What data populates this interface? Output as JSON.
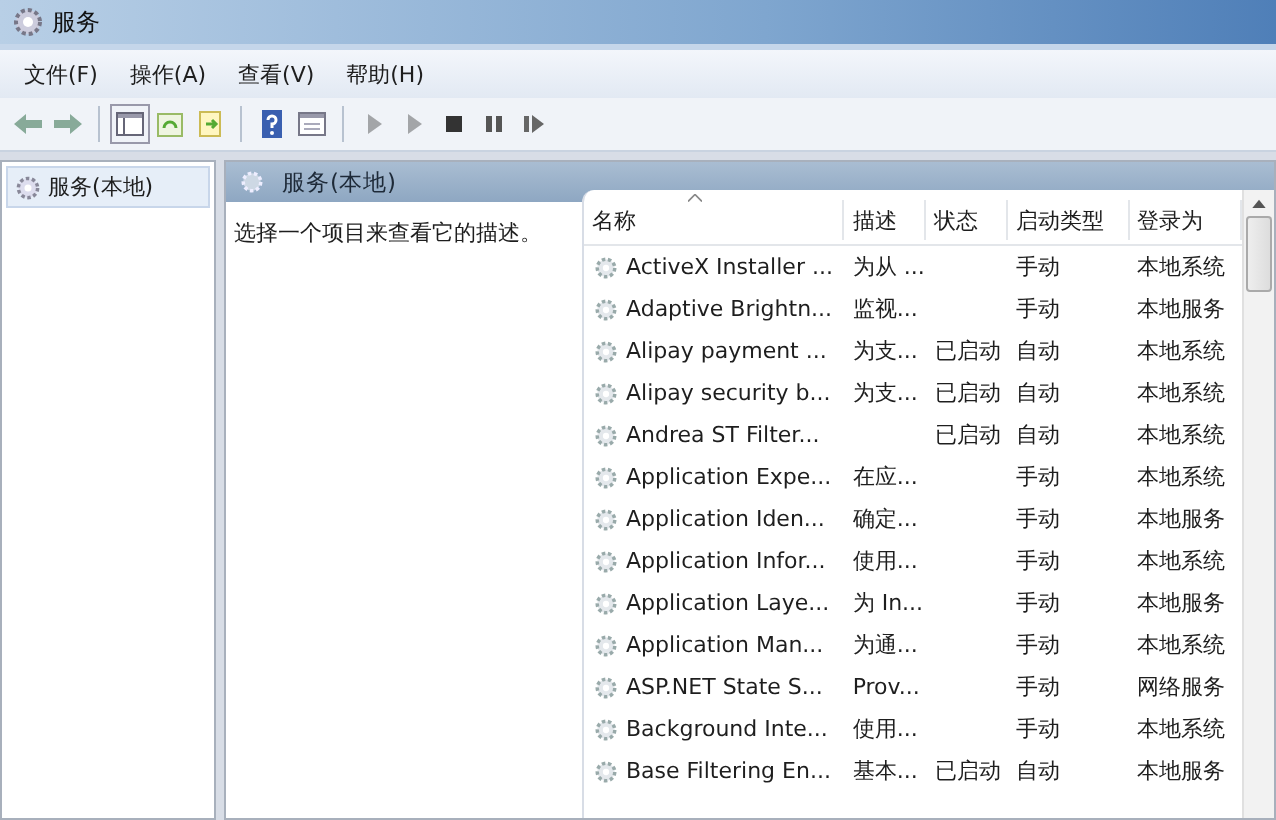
{
  "window": {
    "title": "服务"
  },
  "menu": [
    "文件(F)",
    "操作(A)",
    "查看(V)",
    "帮助(H)"
  ],
  "toolbar": [
    {
      "kind": "back",
      "disabled": false
    },
    {
      "kind": "forward",
      "disabled": false
    },
    {
      "kind": "sep"
    },
    {
      "kind": "tree",
      "disabled": false
    },
    {
      "kind": "refresh",
      "disabled": false
    },
    {
      "kind": "export",
      "disabled": false
    },
    {
      "kind": "sep"
    },
    {
      "kind": "help",
      "disabled": false
    },
    {
      "kind": "props",
      "disabled": false
    },
    {
      "kind": "sep"
    },
    {
      "kind": "play",
      "disabled": true
    },
    {
      "kind": "play",
      "disabled": true
    },
    {
      "kind": "stop",
      "disabled": false
    },
    {
      "kind": "pause",
      "disabled": false
    },
    {
      "kind": "restart",
      "disabled": false
    }
  ],
  "tree": {
    "items": [
      {
        "label": "服务(本地)",
        "selected": true
      }
    ]
  },
  "panel": {
    "title": "服务(本地)",
    "description": "选择一个项目来查看它的描述。"
  },
  "table": {
    "columns": [
      "名称",
      "描述",
      "状态",
      "启动类型",
      "登录为"
    ],
    "rows": [
      {
        "name": "ActiveX Installer ...",
        "description": "为从 ...",
        "startup": "手动",
        "logon": "本地系统"
      },
      {
        "name": "Adaptive Brightn...",
        "description": "监视...",
        "startup": "手动",
        "logon": "本地服务"
      },
      {
        "name": "Alipay payment ...",
        "description": "为支...",
        "status": "已启动",
        "startup": "自动",
        "logon": "本地系统"
      },
      {
        "name": "Alipay security b...",
        "description": "为支...",
        "status": "已启动",
        "startup": "自动",
        "logon": "本地系统"
      },
      {
        "name": "Andrea ST Filter...",
        "status": "已启动",
        "startup": "自动",
        "logon": "本地系统"
      },
      {
        "name": "Application Expe...",
        "description": "在应...",
        "startup": "手动",
        "logon": "本地系统"
      },
      {
        "name": "Application Iden...",
        "description": "确定...",
        "startup": "手动",
        "logon": "本地服务"
      },
      {
        "name": "Application Infor...",
        "description": "使用...",
        "startup": "手动",
        "logon": "本地系统"
      },
      {
        "name": "Application Laye...",
        "description": "为 In...",
        "startup": "手动",
        "logon": "本地服务"
      },
      {
        "name": "Application Man...",
        "description": "为通...",
        "startup": "手动",
        "logon": "本地系统"
      },
      {
        "name": "ASP.NET State S...",
        "description": "Prov...",
        "startup": "手动",
        "logon": "网络服务"
      },
      {
        "name": "Background Inte...",
        "description": "使用...",
        "startup": "手动",
        "logon": "本地系统"
      },
      {
        "name": "Base Filtering En...",
        "description": "基本...",
        "status": "已启动",
        "startup": "自动",
        "logon": "本地服务"
      }
    ]
  }
}
